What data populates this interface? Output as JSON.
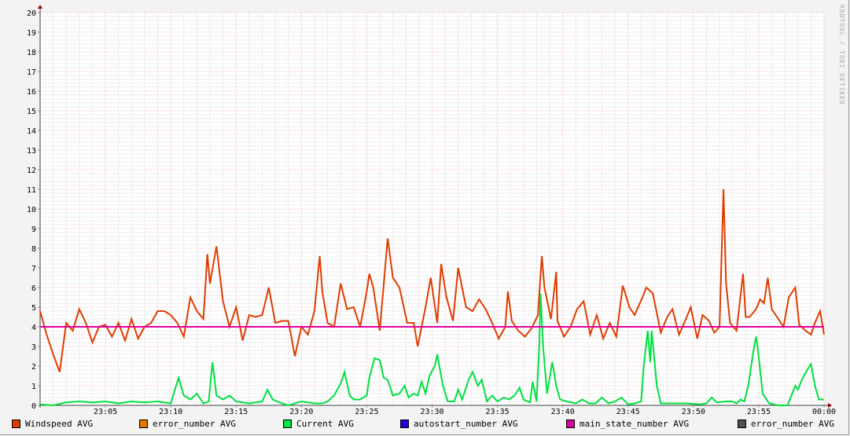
{
  "chart_data": {
    "type": "line",
    "title": "",
    "xlabel": "",
    "ylabel": "",
    "ylim": [
      0,
      20
    ],
    "yticks": [
      "0",
      "1",
      "2",
      "3",
      "4",
      "5",
      "6",
      "7",
      "8",
      "9",
      "10",
      "11",
      "12",
      "13",
      "14",
      "15",
      "16",
      "17",
      "18",
      "19",
      "20"
    ],
    "x_range_minutes": [
      0,
      60
    ],
    "xticks": [
      {
        "minute": 5,
        "label": "23:05"
      },
      {
        "minute": 10,
        "label": "23:10"
      },
      {
        "minute": 15,
        "label": "23:15"
      },
      {
        "minute": 20,
        "label": "23:20"
      },
      {
        "minute": 25,
        "label": "23:25"
      },
      {
        "minute": 30,
        "label": "23:30"
      },
      {
        "minute": 35,
        "label": "23:35"
      },
      {
        "minute": 40,
        "label": "23:40"
      },
      {
        "minute": 45,
        "label": "23:45"
      },
      {
        "minute": 50,
        "label": "23:50"
      },
      {
        "minute": 55,
        "label": "23:55"
      },
      {
        "minute": 60,
        "label": "00:00"
      }
    ],
    "grid": true,
    "legend_position": "bottom",
    "watermark": "RRDTOOL / TOBI OETIKER",
    "series": [
      {
        "name": "Windspeed AVG",
        "color": "#e03c00",
        "points": [
          [
            0,
            4.8
          ],
          [
            0.5,
            3.6
          ],
          [
            1,
            2.6
          ],
          [
            1.5,
            1.7
          ],
          [
            2,
            4.2
          ],
          [
            2.5,
            3.8
          ],
          [
            3,
            4.9
          ],
          [
            3.5,
            4.2
          ],
          [
            4,
            3.2
          ],
          [
            4.5,
            4.0
          ],
          [
            5,
            4.1
          ],
          [
            5.5,
            3.5
          ],
          [
            6,
            4.2
          ],
          [
            6.5,
            3.3
          ],
          [
            7,
            4.4
          ],
          [
            7.5,
            3.4
          ],
          [
            8,
            4.0
          ],
          [
            8.5,
            4.2
          ],
          [
            9,
            4.8
          ],
          [
            9.5,
            4.8
          ],
          [
            10,
            4.6
          ],
          [
            10.5,
            4.2
          ],
          [
            11,
            3.5
          ],
          [
            11.5,
            5.5
          ],
          [
            12,
            4.8
          ],
          [
            12.5,
            4.4
          ],
          [
            12.8,
            7.7
          ],
          [
            13,
            6.2
          ],
          [
            13.5,
            8.1
          ],
          [
            14,
            5.3
          ],
          [
            14.5,
            4.0
          ],
          [
            15,
            5.0
          ],
          [
            15.5,
            3.3
          ],
          [
            16,
            4.6
          ],
          [
            16.5,
            4.5
          ],
          [
            17,
            4.6
          ],
          [
            17.5,
            6.0
          ],
          [
            18,
            4.2
          ],
          [
            18.5,
            4.3
          ],
          [
            19,
            4.3
          ],
          [
            19.5,
            2.5
          ],
          [
            20,
            4.0
          ],
          [
            20.5,
            3.6
          ],
          [
            21,
            4.8
          ],
          [
            21.4,
            7.6
          ],
          [
            21.6,
            5.8
          ],
          [
            22,
            4.2
          ],
          [
            22.5,
            4.0
          ],
          [
            23,
            6.2
          ],
          [
            23.5,
            4.9
          ],
          [
            24,
            5.0
          ],
          [
            24.5,
            4.0
          ],
          [
            25,
            5.8
          ],
          [
            25.2,
            6.7
          ],
          [
            25.5,
            6.0
          ],
          [
            26,
            3.8
          ],
          [
            26.6,
            8.5
          ],
          [
            27,
            6.5
          ],
          [
            27.5,
            6.0
          ],
          [
            28.1,
            4.2
          ],
          [
            28.6,
            4.2
          ],
          [
            28.9,
            3.0
          ],
          [
            29.5,
            5.0
          ],
          [
            29.9,
            6.5
          ],
          [
            30.4,
            4.2
          ],
          [
            30.7,
            7.2
          ],
          [
            31.1,
            5.5
          ],
          [
            31.6,
            4.3
          ],
          [
            32,
            7.0
          ],
          [
            32.6,
            5.0
          ],
          [
            33.1,
            4.8
          ],
          [
            33.6,
            5.4
          ],
          [
            34.1,
            4.9
          ],
          [
            34.6,
            4.2
          ],
          [
            35.1,
            3.4
          ],
          [
            35.6,
            4.0
          ],
          [
            35.8,
            5.8
          ],
          [
            36.1,
            4.3
          ],
          [
            36.6,
            3.8
          ],
          [
            37.1,
            3.5
          ],
          [
            37.6,
            3.9
          ],
          [
            38.1,
            4.6
          ],
          [
            38.4,
            7.6
          ],
          [
            38.6,
            6.0
          ],
          [
            39.1,
            4.4
          ],
          [
            39.5,
            6.8
          ],
          [
            39.6,
            4.3
          ],
          [
            40.1,
            3.5
          ],
          [
            40.6,
            4.0
          ],
          [
            41.1,
            4.9
          ],
          [
            41.6,
            5.3
          ],
          [
            42.1,
            3.6
          ],
          [
            42.6,
            4.6
          ],
          [
            43.1,
            3.4
          ],
          [
            43.6,
            4.2
          ],
          [
            44.1,
            3.5
          ],
          [
            44.6,
            6.1
          ],
          [
            45.1,
            5.0
          ],
          [
            45.5,
            4.6
          ],
          [
            46.1,
            5.5
          ],
          [
            46.4,
            6.0
          ],
          [
            46.9,
            5.7
          ],
          [
            47.5,
            3.7
          ],
          [
            48,
            4.5
          ],
          [
            48.4,
            4.9
          ],
          [
            48.9,
            3.6
          ],
          [
            49.3,
            4.2
          ],
          [
            49.8,
            5.0
          ],
          [
            50.3,
            3.4
          ],
          [
            50.7,
            4.6
          ],
          [
            51.2,
            4.3
          ],
          [
            51.6,
            3.7
          ],
          [
            52,
            4.0
          ],
          [
            52.3,
            11.0
          ],
          [
            52.5,
            6.2
          ],
          [
            52.8,
            4.2
          ],
          [
            53.3,
            3.8
          ],
          [
            53.8,
            6.7
          ],
          [
            54,
            4.5
          ],
          [
            54.3,
            4.5
          ],
          [
            54.8,
            4.9
          ],
          [
            55.1,
            5.4
          ],
          [
            55.4,
            5.2
          ],
          [
            55.7,
            6.5
          ],
          [
            56,
            4.9
          ],
          [
            56.4,
            4.5
          ],
          [
            56.9,
            4.0
          ],
          [
            57.3,
            5.5
          ],
          [
            57.8,
            6.0
          ],
          [
            58.1,
            4.1
          ],
          [
            58.6,
            3.8
          ],
          [
            59,
            3.6
          ],
          [
            59.3,
            4.2
          ],
          [
            59.7,
            4.8
          ],
          [
            60,
            3.6
          ]
        ]
      },
      {
        "name": "error_number AVG",
        "color": "#e07800",
        "points": []
      },
      {
        "name": "Current AVG",
        "color": "#00e040",
        "points": [
          [
            0,
            0.05
          ],
          [
            1,
            0
          ],
          [
            2,
            0.15
          ],
          [
            3,
            0.2
          ],
          [
            4,
            0.15
          ],
          [
            5,
            0.2
          ],
          [
            6,
            0.1
          ],
          [
            7,
            0.2
          ],
          [
            8,
            0.15
          ],
          [
            9,
            0.2
          ],
          [
            10,
            0.1
          ],
          [
            10.6,
            1.4
          ],
          [
            11,
            0.5
          ],
          [
            11.5,
            0.3
          ],
          [
            12,
            0.6
          ],
          [
            12.5,
            0.1
          ],
          [
            12.9,
            0.2
          ],
          [
            13.2,
            2.2
          ],
          [
            13.5,
            0.5
          ],
          [
            14,
            0.3
          ],
          [
            14.5,
            0.5
          ],
          [
            15,
            0.2
          ],
          [
            16,
            0.1
          ],
          [
            17,
            0.2
          ],
          [
            17.4,
            0.8
          ],
          [
            17.8,
            0.3
          ],
          [
            18.5,
            0.1
          ],
          [
            19,
            0
          ],
          [
            20,
            0.2
          ],
          [
            21,
            0.1
          ],
          [
            21.6,
            0.1
          ],
          [
            22,
            0.2
          ],
          [
            22.5,
            0.5
          ],
          [
            23,
            1.1
          ],
          [
            23.3,
            1.7
          ],
          [
            23.7,
            0.5
          ],
          [
            24,
            0.3
          ],
          [
            24.5,
            0.3
          ],
          [
            25,
            0.5
          ],
          [
            25.2,
            1.4
          ],
          [
            25.6,
            2.4
          ],
          [
            26,
            2.3
          ],
          [
            26.3,
            1.4
          ],
          [
            26.6,
            1.3
          ],
          [
            27,
            0.5
          ],
          [
            27.5,
            0.6
          ],
          [
            27.9,
            1.0
          ],
          [
            28.2,
            0.4
          ],
          [
            28.6,
            0.6
          ],
          [
            28.9,
            0.5
          ],
          [
            29.2,
            1.2
          ],
          [
            29.5,
            0.6
          ],
          [
            29.8,
            1.5
          ],
          [
            30.2,
            2.0
          ],
          [
            30.4,
            2.6
          ],
          [
            30.8,
            1.1
          ],
          [
            31.2,
            0.2
          ],
          [
            31.7,
            0.2
          ],
          [
            32,
            0.8
          ],
          [
            32.3,
            0.3
          ],
          [
            32.8,
            1.3
          ],
          [
            33.1,
            1.7
          ],
          [
            33.5,
            1.0
          ],
          [
            33.8,
            1.3
          ],
          [
            34.2,
            0.2
          ],
          [
            34.6,
            0.5
          ],
          [
            35,
            0.2
          ],
          [
            35.5,
            0.4
          ],
          [
            35.9,
            0.3
          ],
          [
            36.3,
            0.5
          ],
          [
            36.7,
            0.9
          ],
          [
            37,
            0.3
          ],
          [
            37.5,
            0.15
          ],
          [
            37.7,
            1.2
          ],
          [
            38,
            0.2
          ],
          [
            38.2,
            3.0
          ],
          [
            38.3,
            5.7
          ],
          [
            38.5,
            3.0
          ],
          [
            38.8,
            0.6
          ],
          [
            39.2,
            2.2
          ],
          [
            39.5,
            1.0
          ],
          [
            39.8,
            0.3
          ],
          [
            40.3,
            0.2
          ],
          [
            41,
            0.1
          ],
          [
            41.5,
            0.3
          ],
          [
            42,
            0.1
          ],
          [
            42.5,
            0.1
          ],
          [
            43,
            0.4
          ],
          [
            43.5,
            0.1
          ],
          [
            44,
            0.2
          ],
          [
            44.5,
            0.4
          ],
          [
            45,
            0.05
          ],
          [
            45.5,
            0.1
          ],
          [
            46,
            0.2
          ],
          [
            46.2,
            2.0
          ],
          [
            46.5,
            3.8
          ],
          [
            46.7,
            2.2
          ],
          [
            46.8,
            3.8
          ],
          [
            47.2,
            1.0
          ],
          [
            47.5,
            0.1
          ],
          [
            48.5,
            0.1
          ],
          [
            49.5,
            0.1
          ],
          [
            50.5,
            0.05
          ],
          [
            51,
            0.1
          ],
          [
            51.4,
            0.4
          ],
          [
            51.8,
            0.15
          ],
          [
            52.5,
            0.2
          ],
          [
            53,
            0.2
          ],
          [
            53.3,
            0.1
          ],
          [
            53.6,
            0.3
          ],
          [
            53.9,
            0.2
          ],
          [
            54.2,
            1.0
          ],
          [
            54.6,
            2.8
          ],
          [
            54.8,
            3.5
          ],
          [
            55,
            2.5
          ],
          [
            55.3,
            0.6
          ],
          [
            55.8,
            0.1
          ],
          [
            56.5,
            0
          ],
          [
            57.2,
            0
          ],
          [
            57.5,
            0.5
          ],
          [
            57.8,
            1.0
          ],
          [
            58,
            0.8
          ],
          [
            58.3,
            1.3
          ],
          [
            58.7,
            1.8
          ],
          [
            59,
            2.1
          ],
          [
            59.3,
            1.0
          ],
          [
            59.6,
            0.3
          ],
          [
            60,
            0.3
          ]
        ]
      },
      {
        "name": "autostart_number AVG",
        "color": "#2000e0",
        "points": []
      },
      {
        "name": "main_state_number AVG",
        "color": "#e000a0",
        "points": [
          [
            0,
            4
          ],
          [
            60,
            4
          ]
        ]
      },
      {
        "name": "error_number AVG",
        "color": "#505050",
        "points": []
      }
    ]
  }
}
